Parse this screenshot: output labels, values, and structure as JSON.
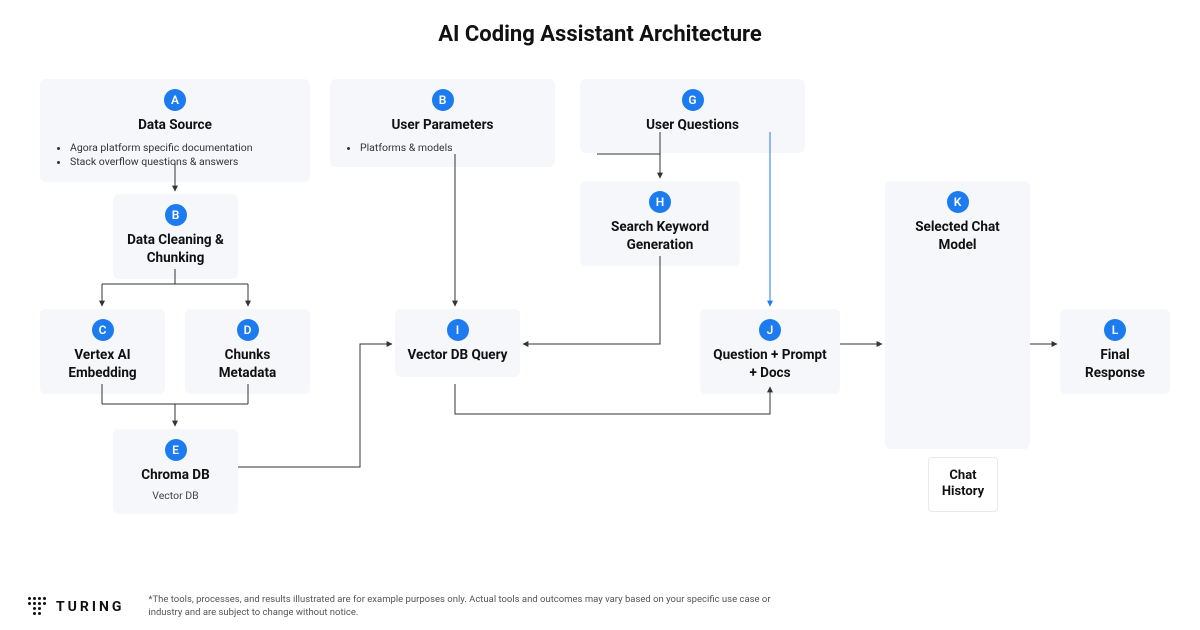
{
  "title": "AI Coding Assistant Architecture",
  "nodes": {
    "A": {
      "badge": "A",
      "title": "Data Source",
      "bullets": [
        "Agora platform specific documentation",
        "Stack overflow questions & answers"
      ]
    },
    "B_params": {
      "badge": "B",
      "title": "User Parameters",
      "bullets": [
        "Platforms & models"
      ]
    },
    "G": {
      "badge": "G",
      "title": "User Questions"
    },
    "B_clean": {
      "badge": "B",
      "title": "Data Cleaning & Chunking"
    },
    "C": {
      "badge": "C",
      "title": "Vertex AI Embedding"
    },
    "D": {
      "badge": "D",
      "title": "Chunks Metadata"
    },
    "E": {
      "badge": "E",
      "title": "Chroma DB",
      "sub": "Vector DB"
    },
    "H": {
      "badge": "H",
      "title": "Search Keyword Generation"
    },
    "I": {
      "badge": "I",
      "title": "Vector DB Query"
    },
    "J": {
      "badge": "J",
      "title": "Question + Prompt + Docs"
    },
    "K": {
      "badge": "K",
      "title": "Selected Chat Model"
    },
    "L": {
      "badge": "L",
      "title": "Final Response"
    }
  },
  "chat_history": "Chat History",
  "footer": {
    "brand": "TURING",
    "disclaimer": "*The tools, processes, and results illustrated are for example purposes only. Actual tools and outcomes may vary based on your specific use case or industry and are subject to change without notice."
  },
  "chart_data": {
    "type": "diagram",
    "title": "AI Coding Assistant Architecture",
    "nodes": [
      {
        "id": "A",
        "label": "Data Source"
      },
      {
        "id": "B_clean",
        "label": "Data Cleaning & Chunking"
      },
      {
        "id": "C",
        "label": "Vertex AI Embedding"
      },
      {
        "id": "D",
        "label": "Chunks Metadata"
      },
      {
        "id": "E",
        "label": "Chroma DB (Vector DB)"
      },
      {
        "id": "B_params",
        "label": "User Parameters"
      },
      {
        "id": "G",
        "label": "User Questions"
      },
      {
        "id": "H",
        "label": "Search Keyword Generation"
      },
      {
        "id": "I",
        "label": "Vector DB Query"
      },
      {
        "id": "J",
        "label": "Question + Prompt + Docs"
      },
      {
        "id": "K",
        "label": "Selected Chat Model"
      },
      {
        "id": "L",
        "label": "Final Response"
      },
      {
        "id": "ChatHistory",
        "label": "Chat History"
      }
    ],
    "edges": [
      {
        "from": "A",
        "to": "B_clean"
      },
      {
        "from": "B_clean",
        "to": "C"
      },
      {
        "from": "B_clean",
        "to": "D"
      },
      {
        "from": "C",
        "to": "E"
      },
      {
        "from": "D",
        "to": "E"
      },
      {
        "from": "B_params",
        "to": "I"
      },
      {
        "from": "G",
        "to": "H"
      },
      {
        "from": "G",
        "to": "J"
      },
      {
        "from": "H",
        "to": "I"
      },
      {
        "from": "E",
        "to": "I"
      },
      {
        "from": "I",
        "to": "J"
      },
      {
        "from": "J",
        "to": "K"
      },
      {
        "from": "K",
        "to": "L"
      },
      {
        "from": "ChatHistory",
        "to": "K"
      }
    ]
  }
}
